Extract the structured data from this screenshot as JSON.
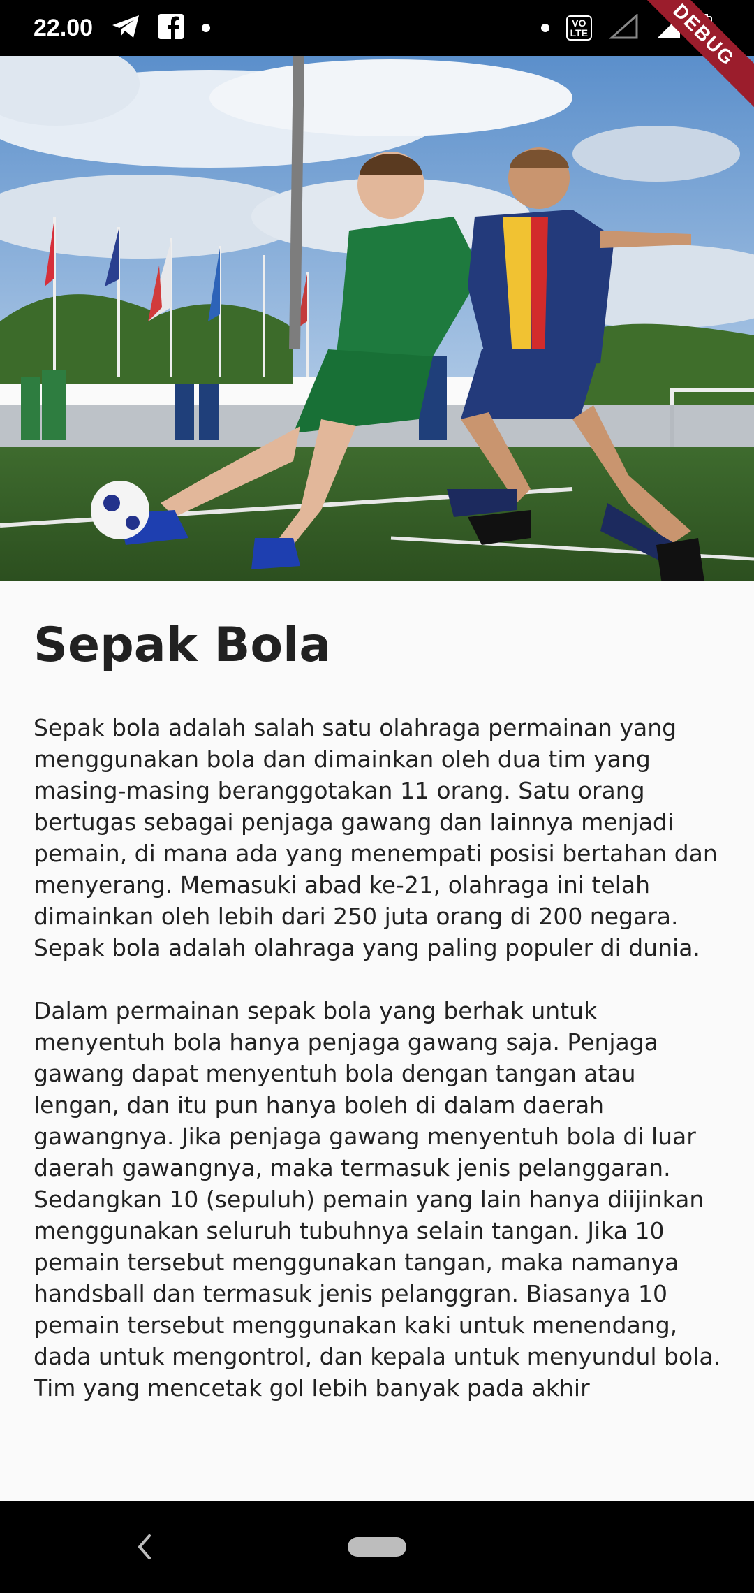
{
  "status_bar": {
    "time": "22.00",
    "icons": [
      "telegram-icon",
      "facebook-icon",
      "dot-icon",
      "dot-icon",
      "volte-icon",
      "signal-icon",
      "battery-icon"
    ],
    "volte_top": "VO",
    "volte_bottom": "LTE"
  },
  "debug_banner": "DEBUG",
  "hero": {
    "image": "soccer-players-photo"
  },
  "article": {
    "title": "Sepak Bola",
    "body": "Sepak bola adalah salah satu olahraga permainan yang menggunakan bola dan dimainkan oleh dua tim yang masing-masing beranggotakan 11 orang. Satu orang bertugas sebagai penjaga gawang dan lainnya menjadi pemain, di mana ada yang menempati posisi bertahan dan menyerang. Memasuki abad ke-21, olahraga ini telah dimainkan oleh lebih dari 250 juta orang di 200 negara. Sepak bola adalah olahraga yang paling populer di dunia.\n\nDalam permainan sepak bola yang berhak untuk menyentuh bola hanya penjaga gawang saja. Penjaga gawang dapat menyentuh bola dengan tangan atau lengan, dan itu pun hanya boleh di dalam daerah gawangnya. Jika penjaga gawang menyentuh bola di luar daerah gawangnya, maka termasuk jenis pelanggaran. Sedangkan 10 (sepuluh) pemain yang lain hanya diijinkan menggunakan seluruh tubuhnya selain tangan. Jika 10 pemain tersebut menggunakan tangan, maka namanya handsball dan termasuk jenis pelanggran. Biasanya 10 pemain tersebut menggunakan kaki untuk menendang, dada untuk mengontrol, dan kepala untuk menyundul bola.\nTim yang mencetak gol lebih banyak pada akhir"
  },
  "nav_bar": {
    "back": "back-icon",
    "home": "home-pill"
  },
  "colors": {
    "status_bar": "#000000",
    "background": "#fafafa",
    "text": "#212121",
    "debug": "#9b1d2c"
  }
}
